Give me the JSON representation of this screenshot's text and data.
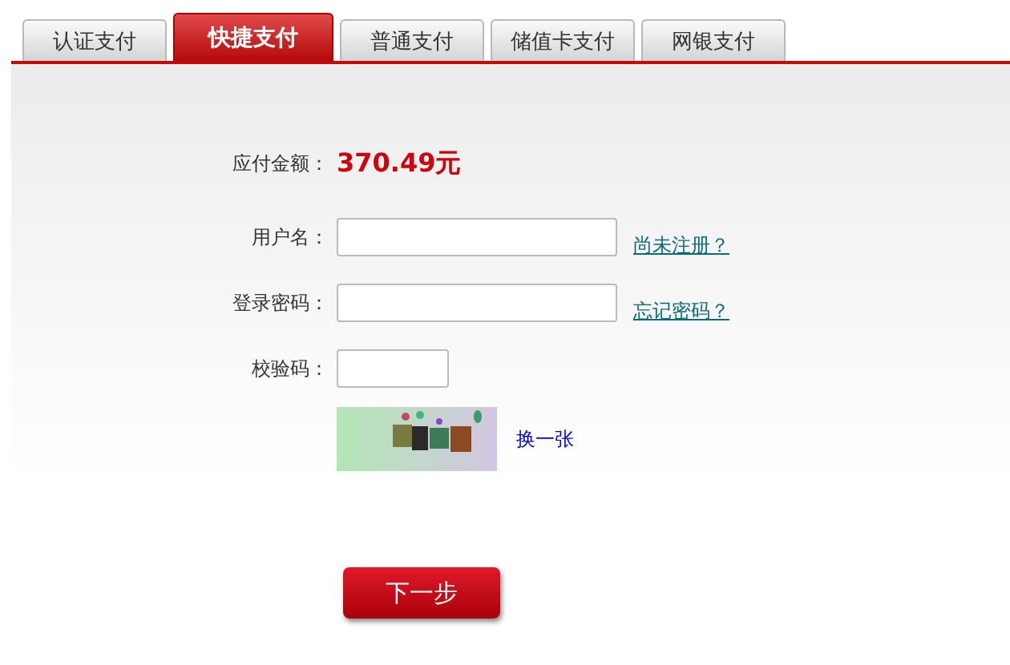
{
  "tabs": [
    {
      "label": "认证支付",
      "selected": false
    },
    {
      "label": "快捷支付",
      "selected": true
    },
    {
      "label": "普通支付",
      "selected": false
    },
    {
      "label": "储值卡支付",
      "selected": false
    },
    {
      "label": "网银支付",
      "selected": false
    }
  ],
  "amount": {
    "label": "应付金额：",
    "value": "370.49元"
  },
  "fields": [
    {
      "label": "用户名：",
      "link": "尚未注册？",
      "kind": "wide"
    },
    {
      "label": "登录密码：",
      "link": "忘记密码？",
      "kind": "wide"
    },
    {
      "label": "校验码：",
      "kind": "narrow"
    }
  ],
  "captcha": {
    "kind": "picture",
    "refresh": "换一张"
  },
  "submit": "下一步"
}
